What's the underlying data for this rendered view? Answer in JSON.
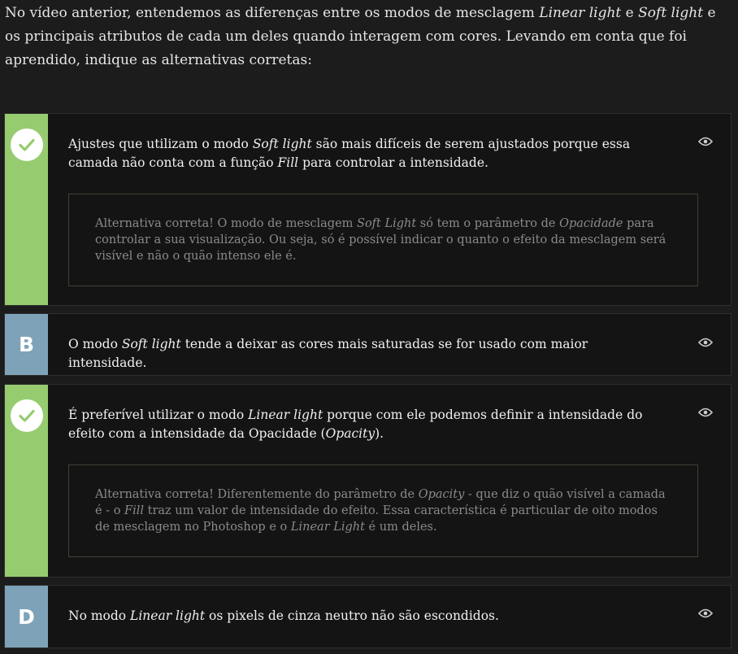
{
  "question": {
    "p1": "No vídeo anterior, entendemos as diferenças entre os modos de mesclagem ",
    "i1": "Linear light",
    "p2": " e ",
    "i2": "Soft light",
    "p3": " e os principais atributos de cada um deles quando interagem com cores. Levando em conta que foi aprendido, indique as alternativas corretas:"
  },
  "alternatives": [
    {
      "status": "correct",
      "icon": "check-icon",
      "text": {
        "p1": "Ajustes que utilizam o modo ",
        "i1": "Soft light",
        "p2": " são mais difíceis de serem ajustados porque essa camada não conta com a função ",
        "i2": "Fill",
        "p3": " para controlar a intensidade."
      },
      "feedback": {
        "p1": "Alternativa correta! O modo de mesclagem ",
        "i1": "Soft Light",
        "p2": " só tem o parâmetro de ",
        "i2": "Opacidade",
        "p3": " para controlar a sua visualização. Ou seja, só é possível indicar o quanto o efeito da mesclagem será visível e não o quão intenso ele é."
      }
    },
    {
      "status": "unselected",
      "letter": "B",
      "text": {
        "p1": "O modo ",
        "i1": "Soft light",
        "p2": " tende a deixar as cores mais saturadas se for usado com maior intensidade."
      }
    },
    {
      "status": "correct",
      "icon": "check-icon",
      "text": {
        "p1": "É preferível utilizar o modo ",
        "i1": "Linear light",
        "p2": " porque com ele podemos definir a intensidade do efeito com a intensidade da Opacidade (",
        "i2": "Opacity",
        "p3": ")."
      },
      "feedback": {
        "p1": "Alternativa correta! Diferentemente do parâmetro de ",
        "i1": "Opacity",
        "p2": " - que diz o quão visível a camada é - o ",
        "i2": "Fill",
        "p3": " traz um valor de intensidade do efeito. Essa característica é particular de oito modos de mesclagem no Photoshop e o ",
        "i3": "Linear Light",
        "p4": " é um deles."
      }
    },
    {
      "status": "unselected",
      "letter": "D",
      "text": {
        "p1": "No modo ",
        "i1": "Linear light",
        "p2": " os pixels de cinza neutro não são escondidos."
      }
    }
  ],
  "colors": {
    "correct": "#96cc6f",
    "letter_badge": "#7ea3b9",
    "card_bg": "#141414",
    "page_bg": "#1c1c1c"
  },
  "icons": {
    "reveal": "eye-icon",
    "correct": "check-icon"
  }
}
